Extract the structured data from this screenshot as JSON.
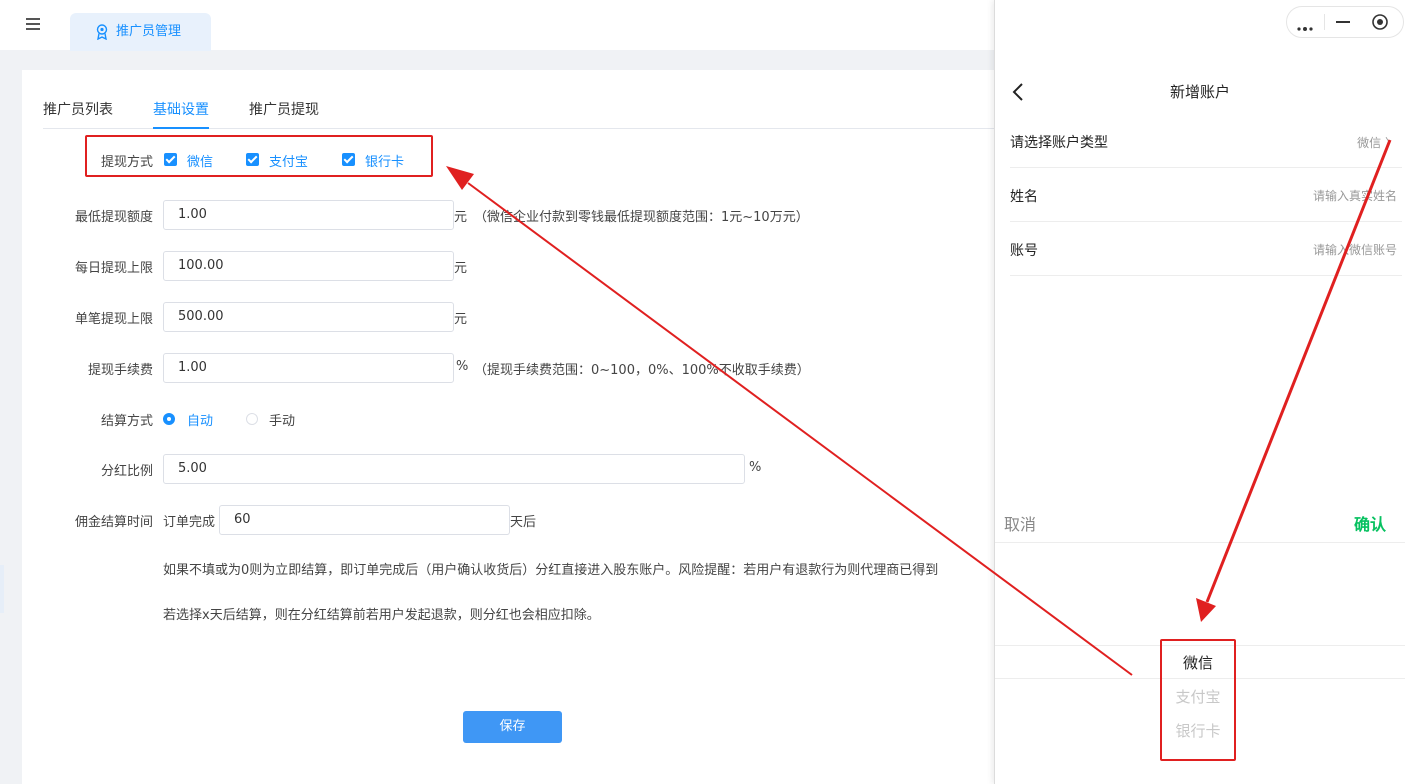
{
  "header": {
    "tab_label": "推广员管理"
  },
  "subtabs": [
    "推广员列表",
    "基础设置",
    "推广员提现"
  ],
  "form": {
    "withdraw_method_label": "提现方式",
    "withdraw_methods": [
      "微信",
      "支付宝",
      "银行卡"
    ],
    "min_label": "最低提现额度",
    "min_value": "1.00",
    "min_unit": "元",
    "min_hint": "（微信企业付款到零钱最低提现额度范围：1元~10万元）",
    "daily_label": "每日提现上限",
    "daily_value": "100.00",
    "daily_unit": "元",
    "single_label": "单笔提现上限",
    "single_value": "500.00",
    "single_unit": "元",
    "fee_label": "提现手续费",
    "fee_value": "1.00",
    "fee_unit": "%",
    "fee_hint": "（提现手续费范围：0~100，0%、100%不收取手续费）",
    "settle_label": "结算方式",
    "settle_auto": "自动",
    "settle_manual": "手动",
    "dividend_label": "分红比例",
    "dividend_value": "5.00",
    "dividend_unit": "%",
    "commission_label": "佣金结算时间",
    "commission_prefix": "订单完成",
    "commission_value": "60",
    "commission_suffix": "天后",
    "note1": "如果不填或为0则为立即结算，即订单完成后（用户确认收货后）分红直接进入股东账户。风险提醒：若用户有退款行为则代理商已得到",
    "note2": "若选择x天后结算，则在分红结算前若用户发起退款，则分红也会相应扣除。",
    "save_label": "保存"
  },
  "phone": {
    "title": "新增账户",
    "rows": [
      {
        "label": "请选择账户类型",
        "value": "微信 〉"
      },
      {
        "label": "姓名",
        "value": "请输入真实姓名"
      },
      {
        "label": "账号",
        "value": "请输入微信账号"
      }
    ],
    "cancel": "取消",
    "confirm": "确认",
    "picker_options": [
      "微信",
      "支付宝",
      "银行卡"
    ]
  },
  "colors": {
    "accent": "#1890ff",
    "confirm": "#07c160",
    "annotation": "#e02020"
  }
}
